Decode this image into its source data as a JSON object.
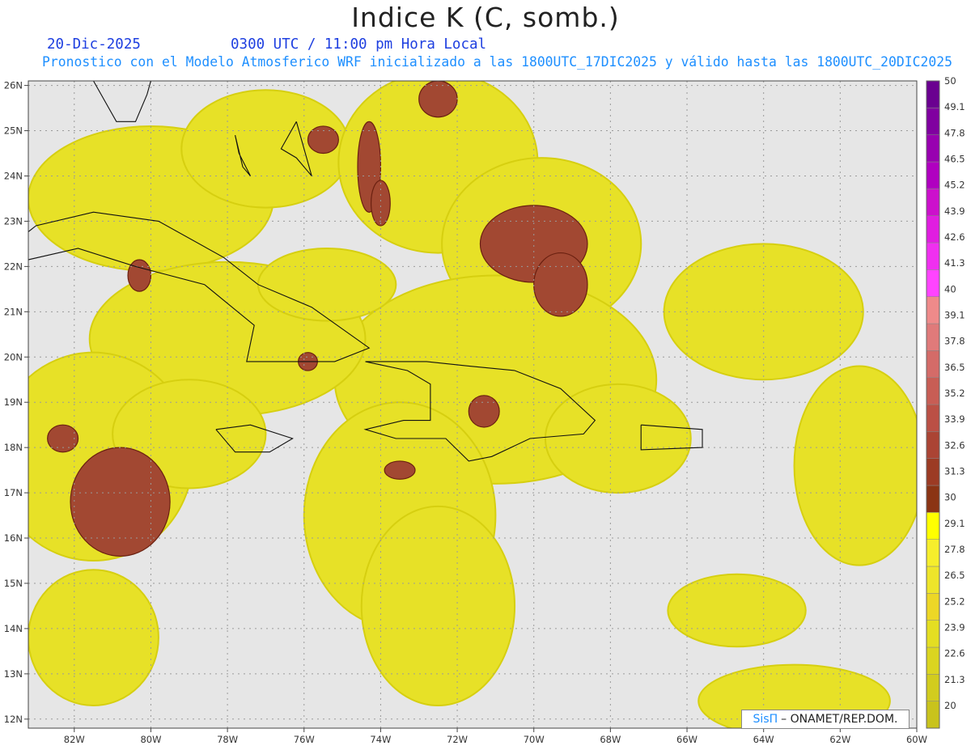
{
  "title": "Indice K (C, somb.)",
  "date": "20-Dic-2025",
  "time": "0300 UTC / 11:00 pm Hora Local",
  "subtitle": "Pronostico con el Modelo Atmosferico WRF inicializado a las 1800UTC_17DIC2025 y valido hasta las  1800UTC_20DIC2025",
  "subtitle_display": "Pronostico con el Modelo Atmosferico WRF inicializado a las 1800UTC_17DIC2025 y válido hasta las  1800UTC_20DIC2025",
  "credit": {
    "brand": "SisΠ",
    "text": "– ONAMET/REP.DOM."
  },
  "map": {
    "lon_range": [
      -83.2,
      -60
    ],
    "lat_range": [
      11.8,
      26.1
    ],
    "lon_ticks": [
      "82W",
      "80W",
      "78W",
      "76W",
      "74W",
      "72W",
      "70W",
      "68W",
      "66W",
      "64W",
      "62W",
      "60W"
    ],
    "lon_tick_values": [
      -82,
      -80,
      -78,
      -76,
      -74,
      -72,
      -70,
      -68,
      -66,
      -64,
      -62,
      -60
    ],
    "lat_ticks": [
      "12N",
      "13N",
      "14N",
      "15N",
      "16N",
      "17N",
      "18N",
      "19N",
      "20N",
      "21N",
      "22N",
      "23N",
      "24N",
      "25N",
      "26N"
    ],
    "lat_tick_values": [
      12,
      13,
      14,
      15,
      16,
      17,
      18,
      19,
      20,
      21,
      22,
      23,
      24,
      25,
      26
    ],
    "background_color": "#e6e6e6",
    "gridlines": true
  },
  "colorbar": {
    "labels": [
      "20",
      "21.3",
      "22.6",
      "23.9",
      "25.2",
      "26.5",
      "27.8",
      "29.1",
      "30",
      "31.3",
      "32.6",
      "33.9",
      "35.2",
      "36.5",
      "37.8",
      "39.1",
      "40",
      "41.3",
      "42.6",
      "43.9",
      "45.2",
      "46.5",
      "47.8",
      "49.1",
      "50"
    ],
    "colors": [
      "#c9c31c",
      "#d2cc1e",
      "#dbd520",
      "#e4de22",
      "#edd726",
      "#eee52a",
      "#f6ee2c",
      "#ffff00",
      "#8b3414",
      "#9c3b24",
      "#ab4434",
      "#bb5045",
      "#c85d55",
      "#d46b68",
      "#e07a7a",
      "#ef8a8a",
      "#ff44ff",
      "#f030f0",
      "#e01ee0",
      "#cc10cc",
      "#b000c0",
      "#9800b0",
      "#8000a0",
      "#6a0090"
    ]
  },
  "regions_yellow": [
    {
      "lon": -80,
      "lat": 23.5,
      "rx": 3.2,
      "ry": 1.6
    },
    {
      "lon": -77,
      "lat": 24.6,
      "rx": 2.2,
      "ry": 1.3
    },
    {
      "lon": -72.5,
      "lat": 24.3,
      "rx": 2.6,
      "ry": 2
    },
    {
      "lon": -69.8,
      "lat": 22.5,
      "rx": 2.6,
      "ry": 1.9
    },
    {
      "lon": -71,
      "lat": 19.5,
      "rx": 4.2,
      "ry": 2.3
    },
    {
      "lon": -78,
      "lat": 20.4,
      "rx": 3.6,
      "ry": 1.7
    },
    {
      "lon": -81.5,
      "lat": 17.8,
      "rx": 2.6,
      "ry": 2.3
    },
    {
      "lon": -79,
      "lat": 18.3,
      "rx": 2,
      "ry": 1.2
    },
    {
      "lon": -73.5,
      "lat": 16.5,
      "rx": 2.5,
      "ry": 2.5
    },
    {
      "lon": -72.5,
      "lat": 14.5,
      "rx": 2,
      "ry": 2.2
    },
    {
      "lon": -64,
      "lat": 21,
      "rx": 2.6,
      "ry": 1.5
    },
    {
      "lon": -61.5,
      "lat": 17.6,
      "rx": 1.7,
      "ry": 2.2
    },
    {
      "lon": -64.7,
      "lat": 14.4,
      "rx": 1.8,
      "ry": 0.8
    },
    {
      "lon": -63.2,
      "lat": 12.4,
      "rx": 2.5,
      "ry": 0.8
    },
    {
      "lon": -81.5,
      "lat": 13.8,
      "rx": 1.7,
      "ry": 1.5
    },
    {
      "lon": -67.8,
      "lat": 18.2,
      "rx": 1.9,
      "ry": 1.2
    },
    {
      "lon": -75.4,
      "lat": 21.6,
      "rx": 1.8,
      "ry": 0.8
    }
  ],
  "regions_brown": [
    {
      "lon": -80.8,
      "lat": 16.8,
      "rx": 1.3,
      "ry": 1.2
    },
    {
      "lon": -70,
      "lat": 22.5,
      "rx": 1.4,
      "ry": 0.85
    },
    {
      "lon": -69.3,
      "lat": 21.6,
      "rx": 0.7,
      "ry": 0.7
    },
    {
      "lon": -74.3,
      "lat": 24.2,
      "rx": 0.3,
      "ry": 1
    },
    {
      "lon": -74,
      "lat": 23.4,
      "rx": 0.25,
      "ry": 0.5
    },
    {
      "lon": -72.5,
      "lat": 25.7,
      "rx": 0.5,
      "ry": 0.4
    },
    {
      "lon": -75.5,
      "lat": 24.8,
      "rx": 0.4,
      "ry": 0.3
    },
    {
      "lon": -71.3,
      "lat": 18.8,
      "rx": 0.4,
      "ry": 0.35
    },
    {
      "lon": -82.3,
      "lat": 18.2,
      "rx": 0.4,
      "ry": 0.3
    },
    {
      "lon": -80.3,
      "lat": 21.8,
      "rx": 0.3,
      "ry": 0.35
    },
    {
      "lon": -75.9,
      "lat": 19.9,
      "rx": 0.25,
      "ry": 0.2
    },
    {
      "lon": -73.5,
      "lat": 17.5,
      "rx": 0.4,
      "ry": 0.2
    }
  ],
  "coast_labels": []
}
